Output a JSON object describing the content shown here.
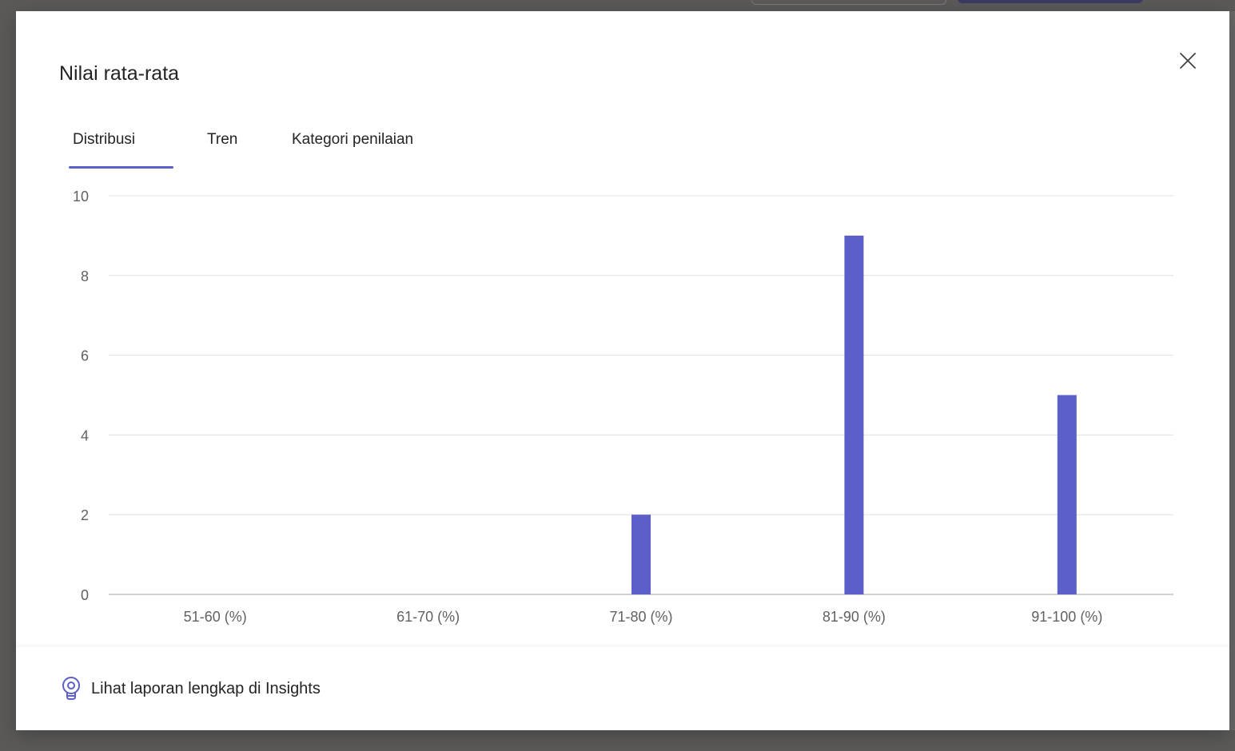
{
  "dialog": {
    "title": "Nilai rata-rata",
    "close_icon": "close-icon"
  },
  "tabs": [
    {
      "label": "Distribusi",
      "selected": true
    },
    {
      "label": "Tren",
      "selected": false
    },
    {
      "label": "Kategori penilaian",
      "selected": false
    }
  ],
  "colors": {
    "accent": "#5b5fc7",
    "bar": "#5b5fc7",
    "grid": "#e0e0e0",
    "axis_text": "#616161"
  },
  "chart_data": {
    "type": "bar",
    "categories": [
      "51-60 (%)",
      "61-70 (%)",
      "71-80 (%)",
      "81-90 (%)",
      "91-100 (%)"
    ],
    "values": [
      0,
      0,
      2,
      9,
      5
    ],
    "ylim": [
      0,
      10
    ],
    "yticks": [
      0,
      2,
      4,
      6,
      8,
      10
    ],
    "grid": true,
    "legend": "none"
  },
  "footer": {
    "link_label": "Lihat laporan lengkap di Insights",
    "icon": "lightbulb-icon"
  }
}
